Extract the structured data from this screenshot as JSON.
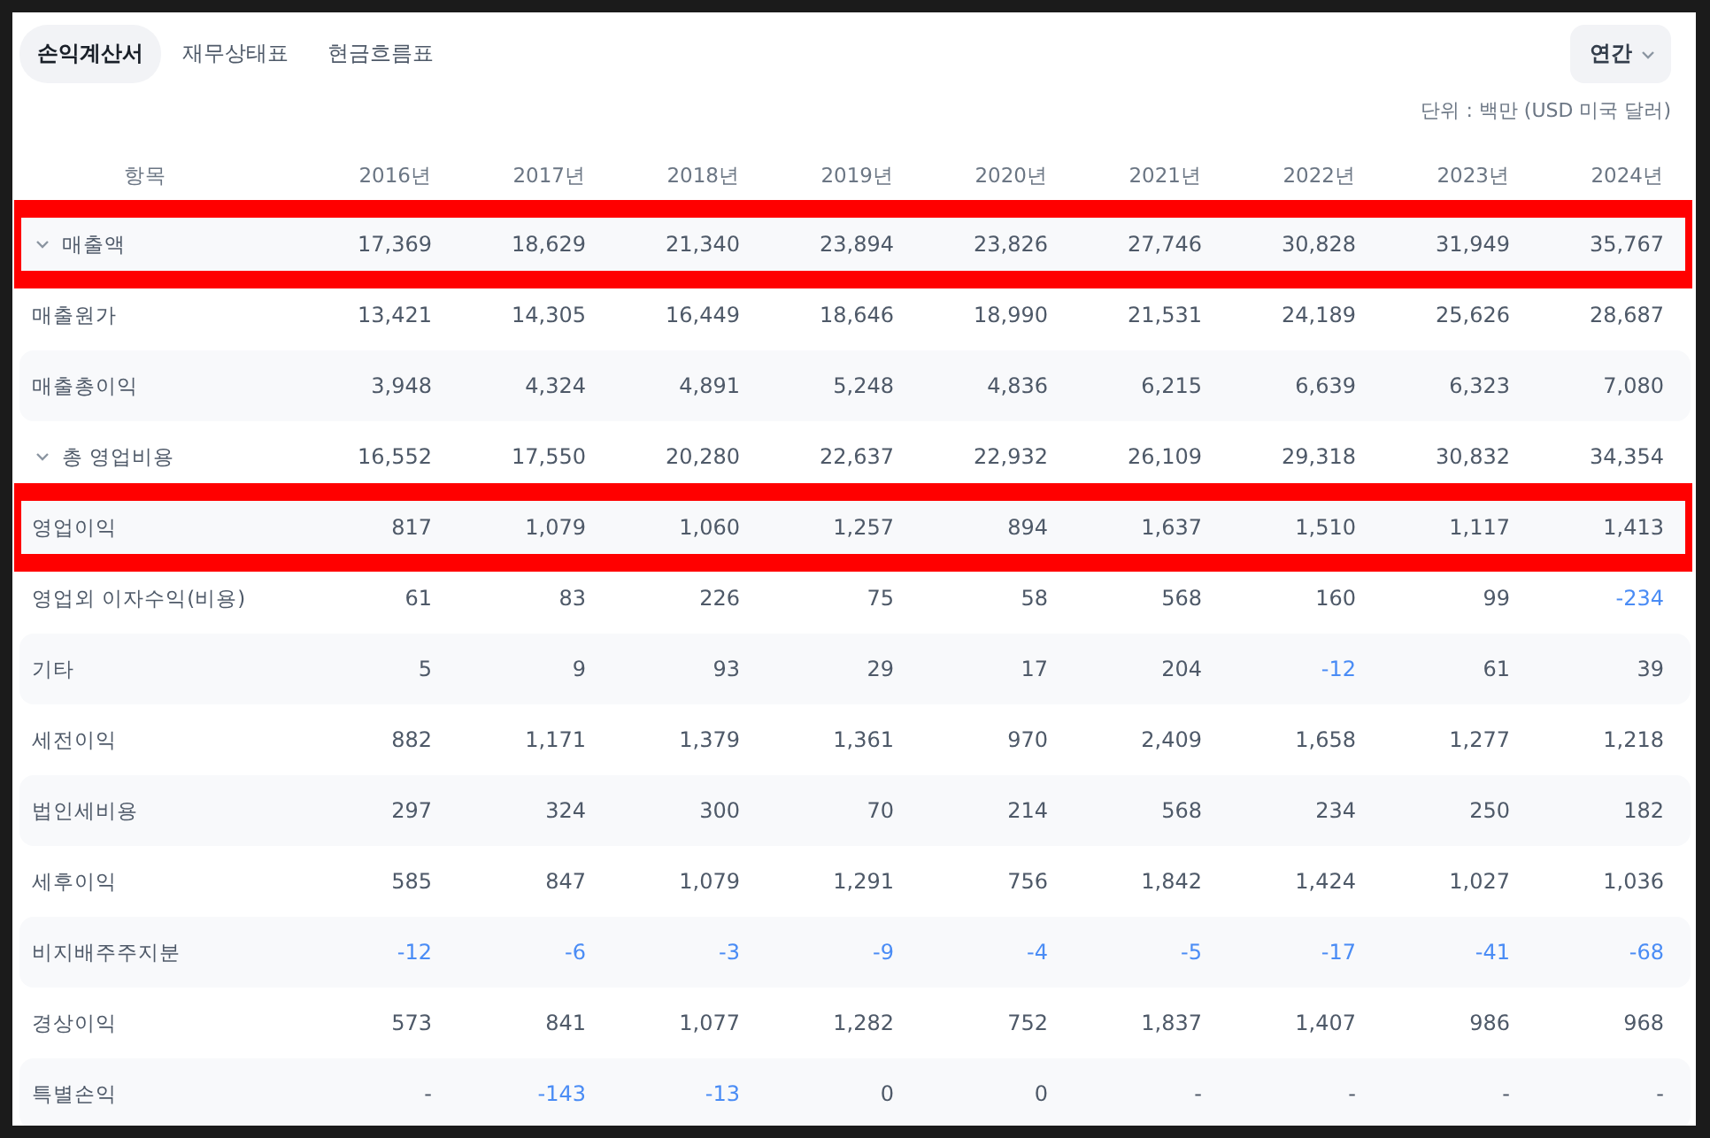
{
  "tabs": [
    {
      "label": "손익계산서",
      "selected": true
    },
    {
      "label": "재무상태표",
      "selected": false
    },
    {
      "label": "현금흐름표",
      "selected": false
    }
  ],
  "period_dropdown": {
    "label": "연간"
  },
  "unit_note": "단위 : 백만 (USD 미국 달러)",
  "table": {
    "label_column": "항목",
    "columns": [
      "2016년",
      "2017년",
      "2018년",
      "2019년",
      "2020년",
      "2021년",
      "2022년",
      "2023년",
      "2024년"
    ],
    "rows": [
      {
        "label": "매출액",
        "expanded": false,
        "highlighted": true,
        "cells": [
          {
            "value": "17,369",
            "negative": false
          },
          {
            "value": "18,629",
            "negative": false
          },
          {
            "value": "21,340",
            "negative": false
          },
          {
            "value": "23,894",
            "negative": false
          },
          {
            "value": "23,826",
            "negative": false
          },
          {
            "value": "27,746",
            "negative": false
          },
          {
            "value": "30,828",
            "negative": false
          },
          {
            "value": "31,949",
            "negative": false
          },
          {
            "value": "35,767",
            "negative": false
          }
        ]
      },
      {
        "label": "매출원가",
        "highlighted": false,
        "cells": [
          {
            "value": "13,421",
            "negative": false
          },
          {
            "value": "14,305",
            "negative": false
          },
          {
            "value": "16,449",
            "negative": false
          },
          {
            "value": "18,646",
            "negative": false
          },
          {
            "value": "18,990",
            "negative": false
          },
          {
            "value": "21,531",
            "negative": false
          },
          {
            "value": "24,189",
            "negative": false
          },
          {
            "value": "25,626",
            "negative": false
          },
          {
            "value": "28,687",
            "negative": false
          }
        ]
      },
      {
        "label": "매출총이익",
        "highlighted": false,
        "cells": [
          {
            "value": "3,948",
            "negative": false
          },
          {
            "value": "4,324",
            "negative": false
          },
          {
            "value": "4,891",
            "negative": false
          },
          {
            "value": "5,248",
            "negative": false
          },
          {
            "value": "4,836",
            "negative": false
          },
          {
            "value": "6,215",
            "negative": false
          },
          {
            "value": "6,639",
            "negative": false
          },
          {
            "value": "6,323",
            "negative": false
          },
          {
            "value": "7,080",
            "negative": false
          }
        ]
      },
      {
        "label": "총 영업비용",
        "expanded": false,
        "highlighted": false,
        "cells": [
          {
            "value": "16,552",
            "negative": false
          },
          {
            "value": "17,550",
            "negative": false
          },
          {
            "value": "20,280",
            "negative": false
          },
          {
            "value": "22,637",
            "negative": false
          },
          {
            "value": "22,932",
            "negative": false
          },
          {
            "value": "26,109",
            "negative": false
          },
          {
            "value": "29,318",
            "negative": false
          },
          {
            "value": "30,832",
            "negative": false
          },
          {
            "value": "34,354",
            "negative": false
          }
        ]
      },
      {
        "label": "영업이익",
        "highlighted": true,
        "cells": [
          {
            "value": "817",
            "negative": false
          },
          {
            "value": "1,079",
            "negative": false
          },
          {
            "value": "1,060",
            "negative": false
          },
          {
            "value": "1,257",
            "negative": false
          },
          {
            "value": "894",
            "negative": false
          },
          {
            "value": "1,637",
            "negative": false
          },
          {
            "value": "1,510",
            "negative": false
          },
          {
            "value": "1,117",
            "negative": false
          },
          {
            "value": "1,413",
            "negative": false
          }
        ]
      },
      {
        "label": "영업외 이자수익(비용)",
        "highlighted": false,
        "cells": [
          {
            "value": "61",
            "negative": false
          },
          {
            "value": "83",
            "negative": false
          },
          {
            "value": "226",
            "negative": false
          },
          {
            "value": "75",
            "negative": false
          },
          {
            "value": "58",
            "negative": false
          },
          {
            "value": "568",
            "negative": false
          },
          {
            "value": "160",
            "negative": false
          },
          {
            "value": "99",
            "negative": false
          },
          {
            "value": "-234",
            "negative": true
          }
        ]
      },
      {
        "label": "기타",
        "highlighted": false,
        "cells": [
          {
            "value": "5",
            "negative": false
          },
          {
            "value": "9",
            "negative": false
          },
          {
            "value": "93",
            "negative": false
          },
          {
            "value": "29",
            "negative": false
          },
          {
            "value": "17",
            "negative": false
          },
          {
            "value": "204",
            "negative": false
          },
          {
            "value": "-12",
            "negative": true
          },
          {
            "value": "61",
            "negative": false
          },
          {
            "value": "39",
            "negative": false
          }
        ]
      },
      {
        "label": "세전이익",
        "highlighted": false,
        "cells": [
          {
            "value": "882",
            "negative": false
          },
          {
            "value": "1,171",
            "negative": false
          },
          {
            "value": "1,379",
            "negative": false
          },
          {
            "value": "1,361",
            "negative": false
          },
          {
            "value": "970",
            "negative": false
          },
          {
            "value": "2,409",
            "negative": false
          },
          {
            "value": "1,658",
            "negative": false
          },
          {
            "value": "1,277",
            "negative": false
          },
          {
            "value": "1,218",
            "negative": false
          }
        ]
      },
      {
        "label": "법인세비용",
        "highlighted": false,
        "cells": [
          {
            "value": "297",
            "negative": false
          },
          {
            "value": "324",
            "negative": false
          },
          {
            "value": "300",
            "negative": false
          },
          {
            "value": "70",
            "negative": false
          },
          {
            "value": "214",
            "negative": false
          },
          {
            "value": "568",
            "negative": false
          },
          {
            "value": "234",
            "negative": false
          },
          {
            "value": "250",
            "negative": false
          },
          {
            "value": "182",
            "negative": false
          }
        ]
      },
      {
        "label": "세후이익",
        "highlighted": false,
        "cells": [
          {
            "value": "585",
            "negative": false
          },
          {
            "value": "847",
            "negative": false
          },
          {
            "value": "1,079",
            "negative": false
          },
          {
            "value": "1,291",
            "negative": false
          },
          {
            "value": "756",
            "negative": false
          },
          {
            "value": "1,842",
            "negative": false
          },
          {
            "value": "1,424",
            "negative": false
          },
          {
            "value": "1,027",
            "negative": false
          },
          {
            "value": "1,036",
            "negative": false
          }
        ]
      },
      {
        "label": "비지배주주지분",
        "highlighted": false,
        "cells": [
          {
            "value": "-12",
            "negative": true
          },
          {
            "value": "-6",
            "negative": true
          },
          {
            "value": "-3",
            "negative": true
          },
          {
            "value": "-9",
            "negative": true
          },
          {
            "value": "-4",
            "negative": true
          },
          {
            "value": "-5",
            "negative": true
          },
          {
            "value": "-17",
            "negative": true
          },
          {
            "value": "-41",
            "negative": true
          },
          {
            "value": "-68",
            "negative": true
          }
        ]
      },
      {
        "label": "경상이익",
        "highlighted": false,
        "cells": [
          {
            "value": "573",
            "negative": false
          },
          {
            "value": "841",
            "negative": false
          },
          {
            "value": "1,077",
            "negative": false
          },
          {
            "value": "1,282",
            "negative": false
          },
          {
            "value": "752",
            "negative": false
          },
          {
            "value": "1,837",
            "negative": false
          },
          {
            "value": "1,407",
            "negative": false
          },
          {
            "value": "986",
            "negative": false
          },
          {
            "value": "968",
            "negative": false
          }
        ]
      },
      {
        "label": "특별손익",
        "highlighted": false,
        "cells": [
          {
            "value": "-",
            "negative": false
          },
          {
            "value": "-143",
            "negative": true
          },
          {
            "value": "-13",
            "negative": true
          },
          {
            "value": "0",
            "negative": false
          },
          {
            "value": "0",
            "negative": false
          },
          {
            "value": "-",
            "negative": false
          },
          {
            "value": "-",
            "negative": false
          },
          {
            "value": "-",
            "negative": false
          },
          {
            "value": "-",
            "negative": false
          }
        ]
      }
    ]
  }
}
